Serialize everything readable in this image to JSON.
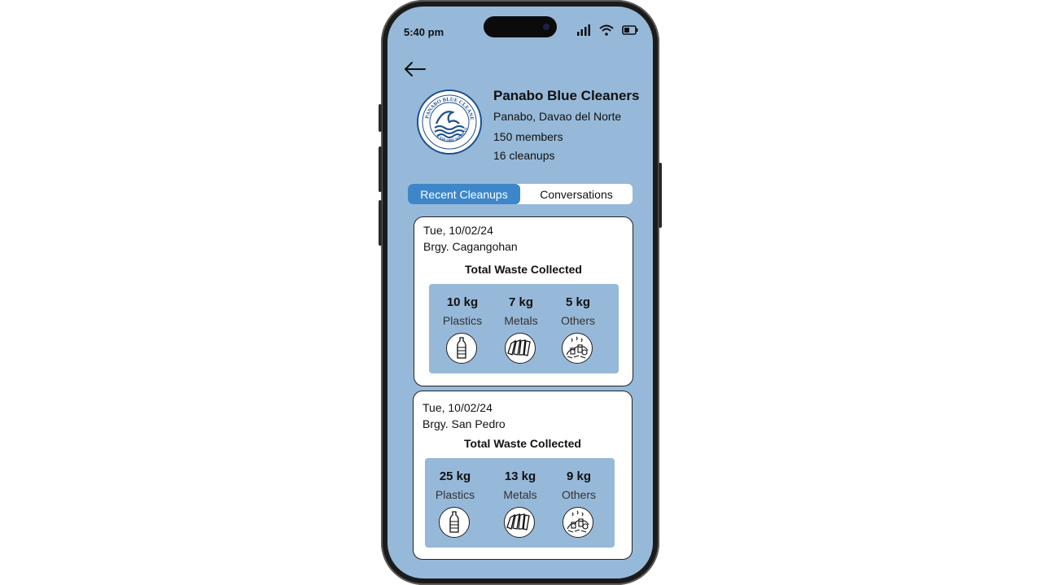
{
  "status": {
    "time": "5:40 pm"
  },
  "org": {
    "name": "Panabo Blue Cleaners",
    "location": "Panabo, Davao del Norte",
    "members": "150 members",
    "cleanups": "16 cleanups",
    "logo_text": "PANABO BLUE CLEANERS · EXPLORE WITH US"
  },
  "tabs": [
    {
      "label": "Recent Cleanups",
      "active": true
    },
    {
      "label": "Conversations",
      "active": false
    }
  ],
  "cleanups": [
    {
      "date": "Tue, 10/02/24",
      "barangay": "Brgy. Cagangohan",
      "heading": "Total Waste Collected",
      "items": [
        {
          "amount": "10 kg",
          "label": "Plastics",
          "icon": "plastic-bottle-icon"
        },
        {
          "amount": "7 kg",
          "label": "Metals",
          "icon": "metal-cans-icon"
        },
        {
          "amount": "5 kg",
          "label": "Others",
          "icon": "mixed-waste-icon"
        }
      ]
    },
    {
      "date": "Tue, 10/02/24",
      "barangay": "Brgy. San Pedro",
      "heading": "Total Waste Collected",
      "items": [
        {
          "amount": "25 kg",
          "label": "Plastics",
          "icon": "plastic-bottle-icon"
        },
        {
          "amount": "13 kg",
          "label": "Metals",
          "icon": "metal-cans-icon"
        },
        {
          "amount": "9 kg",
          "label": "Others",
          "icon": "mixed-waste-icon"
        }
      ]
    }
  ],
  "colors": {
    "screen_bg": "#97b9d9",
    "accent": "#3d86c9",
    "card_bg": "#ffffff",
    "logo_blue": "#1d4f8f"
  }
}
